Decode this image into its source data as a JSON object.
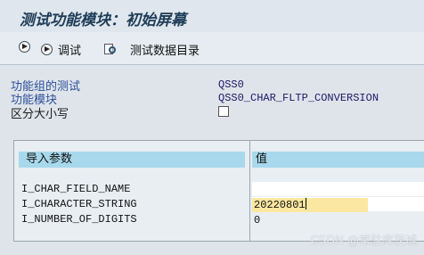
{
  "window": {
    "title": "测试功能模块：初始屏幕"
  },
  "toolbar": {
    "debug_label": "调试",
    "directory_label": "测试数据目录"
  },
  "header_fields": [
    {
      "label": "功能组的测试",
      "value": "QSS0"
    },
    {
      "label": "功能模块",
      "value": "QSS0_CHAR_FLTP_CONVERSION"
    },
    {
      "label": "区分大小写",
      "value": ""
    }
  ],
  "params_table": {
    "header_name": "导入参数",
    "header_value": "值",
    "rows": [
      {
        "name": "I_CHAR_FIELD_NAME",
        "value": ""
      },
      {
        "name": "I_CHARACTER_STRING",
        "value": "20220801"
      },
      {
        "name": "I_NUMBER_OF_DIGITS",
        "value": "0"
      }
    ]
  },
  "watermark": "CSDN @常驻库茨城",
  "colors": {
    "background": "#dfe4ea",
    "label_blue": "#2b4f9b",
    "header_cyan": "#a8d8ec",
    "active_input": "#fbe7a1"
  }
}
